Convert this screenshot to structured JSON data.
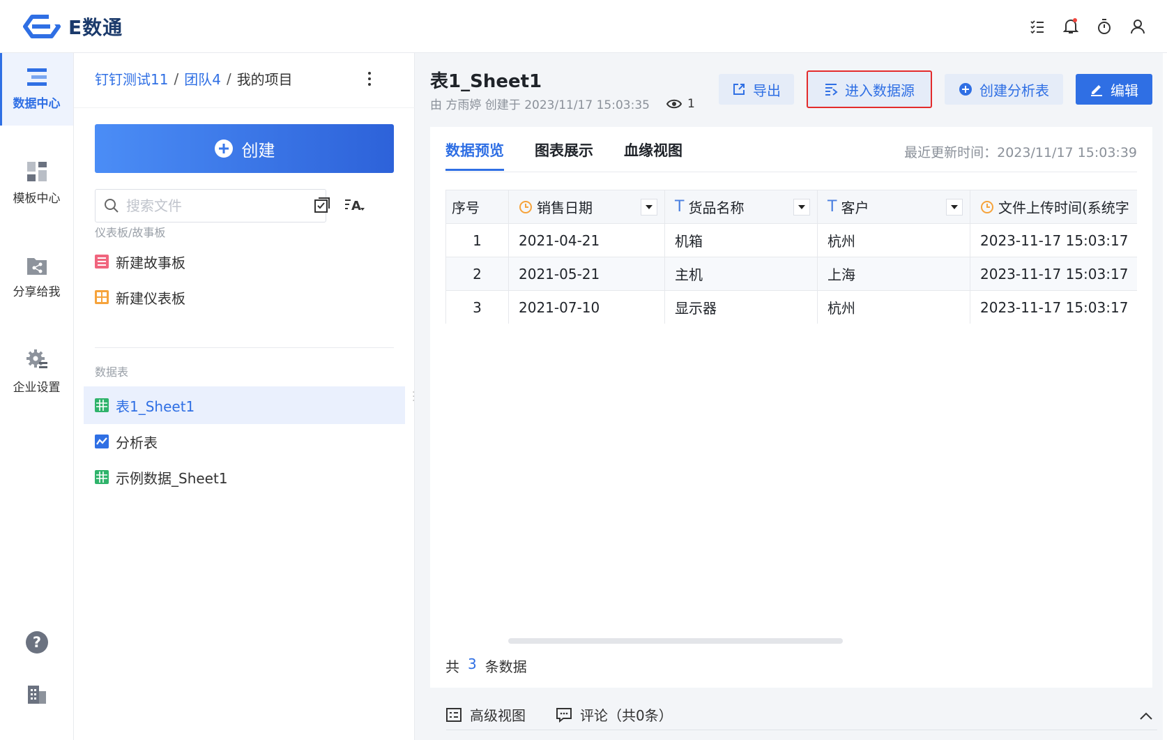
{
  "app": {
    "logo_text": "E数通",
    "brand_color": "#2f6fe4"
  },
  "topbar": {
    "icons": [
      "task-list-icon",
      "bell-icon",
      "timer-icon",
      "user-icon"
    ]
  },
  "nav": {
    "items": [
      {
        "label": "数据中心",
        "icon": "data-center-icon",
        "active": true
      },
      {
        "label": "模板中心",
        "icon": "template-icon",
        "active": false
      },
      {
        "label": "分享给我",
        "icon": "share-icon",
        "active": false
      },
      {
        "label": "企业设置",
        "icon": "gear-icon",
        "active": false
      }
    ],
    "bottom_icons": [
      "help-icon",
      "building-icon"
    ]
  },
  "breadcrumb": {
    "items": [
      "钉钉测试11",
      "团队4",
      "我的项目"
    ],
    "separator": "/"
  },
  "sidebar": {
    "create_label": "创建",
    "search_placeholder": "搜索文件",
    "sections": [
      {
        "label": "仪表板/故事板",
        "items": [
          {
            "label": "新建故事板",
            "icon": "storyboard-icon"
          },
          {
            "label": "新建仪表板",
            "icon": "dashboard-icon"
          }
        ]
      },
      {
        "label": "数据表",
        "items": [
          {
            "label": "表1_Sheet1",
            "icon": "sheet-icon",
            "active": true
          },
          {
            "label": "分析表",
            "icon": "analysis-icon"
          },
          {
            "label": "示例数据_Sheet1",
            "icon": "sheet-icon"
          }
        ]
      }
    ]
  },
  "content": {
    "title": "表1_Sheet1",
    "meta": "由 方雨婷 创建于 2023/11/17 15:03:35",
    "views": "1",
    "actions": {
      "export": "导出",
      "enter_source": "进入数据源",
      "create_analysis": "创建分析表",
      "edit": "编辑"
    },
    "tabs": [
      "数据预览",
      "图表展示",
      "血缘视图"
    ],
    "active_tab": 0,
    "updated": "最近更新时间：2023/11/17 15:03:39",
    "table": {
      "columns": [
        {
          "label": "序号",
          "type": "none"
        },
        {
          "label": "销售日期",
          "type": "date"
        },
        {
          "label": "货品名称",
          "type": "text"
        },
        {
          "label": "客户",
          "type": "text"
        },
        {
          "label": "文件上传时间(系统字",
          "type": "date"
        }
      ],
      "rows": [
        [
          "1",
          "2021-04-21",
          "机箱",
          "杭州",
          "2023-11-17 15:03:17"
        ],
        [
          "2",
          "2021-05-21",
          "主机",
          "上海",
          "2023-11-17 15:03:17"
        ],
        [
          "3",
          "2021-07-10",
          "显示器",
          "杭州",
          "2023-11-17 15:03:17"
        ]
      ]
    },
    "total": {
      "prefix": "共",
      "count": "3",
      "suffix": "条数据"
    }
  },
  "bottombar": {
    "advanced_view": "高级视图",
    "comments": "评论（共0条）"
  }
}
